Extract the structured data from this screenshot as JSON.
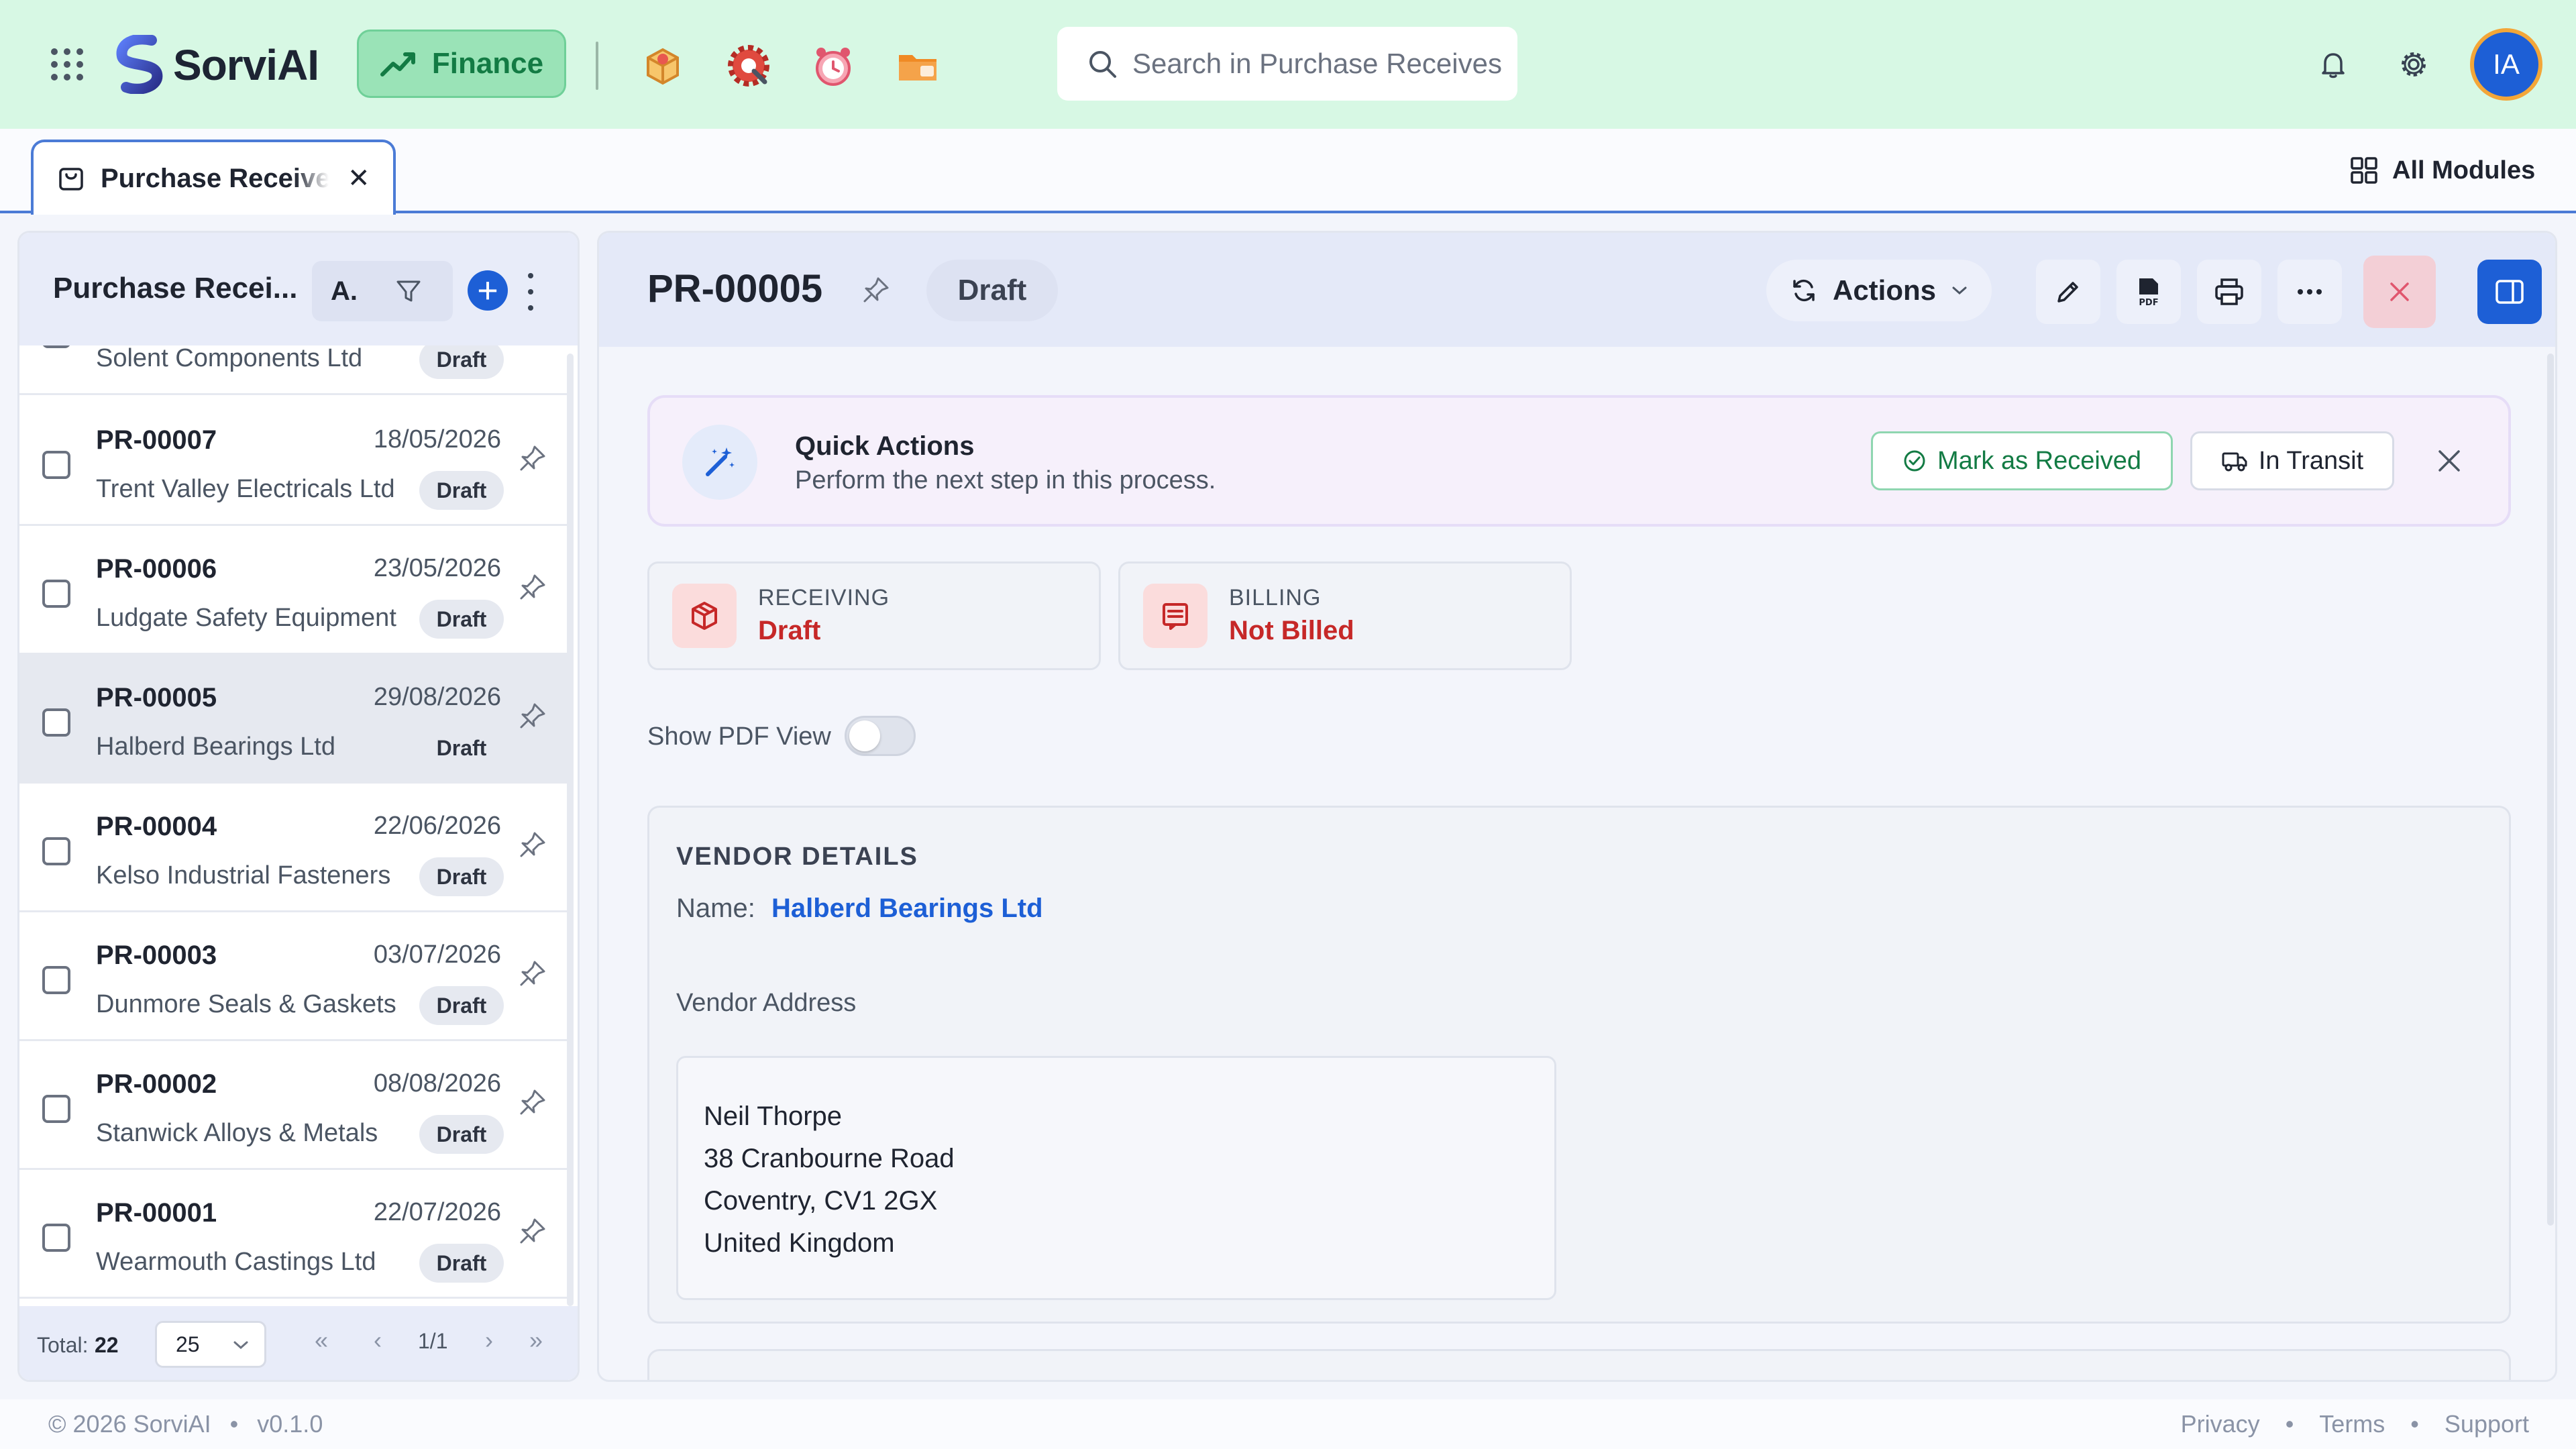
{
  "app": {
    "brand": "SorviAI",
    "module": "Finance"
  },
  "search": {
    "placeholder": "Search in Purchase Receives"
  },
  "user": {
    "initials": "IA"
  },
  "tab": {
    "label": "Purchase Receives",
    "all_modules": "All Modules"
  },
  "list": {
    "title": "Purchase Recei...",
    "sort_label": "A.",
    "rows": [
      {
        "number": "",
        "date": "",
        "vendor": "Solent Components Ltd",
        "status": "Draft"
      },
      {
        "number": "PR-00007",
        "date": "18/05/2026",
        "vendor": "Trent Valley Electricals Ltd",
        "status": "Draft"
      },
      {
        "number": "PR-00006",
        "date": "23/05/2026",
        "vendor": "Ludgate Safety Equipment",
        "status": "Draft"
      },
      {
        "number": "PR-00005",
        "date": "29/08/2026",
        "vendor": "Halberd Bearings Ltd",
        "status": "Draft"
      },
      {
        "number": "PR-00004",
        "date": "22/06/2026",
        "vendor": "Kelso Industrial Fasteners",
        "status": "Draft"
      },
      {
        "number": "PR-00003",
        "date": "03/07/2026",
        "vendor": "Dunmore Seals & Gaskets",
        "status": "Draft"
      },
      {
        "number": "PR-00002",
        "date": "08/08/2026",
        "vendor": "Stanwick Alloys & Metals",
        "status": "Draft"
      },
      {
        "number": "PR-00001",
        "date": "22/07/2026",
        "vendor": "Wearmouth Castings Ltd",
        "status": "Draft"
      }
    ],
    "footer": {
      "total_label": "Total:",
      "total": "22",
      "page_size": "25",
      "page": "1/1"
    }
  },
  "detail": {
    "number": "PR-00005",
    "status": "Draft",
    "actions_label": "Actions",
    "quick_actions": {
      "title": "Quick Actions",
      "subtitle": "Perform the next step in this process.",
      "mark_received": "Mark as Received",
      "in_transit": "In Transit"
    },
    "receiving": {
      "label": "RECEIVING",
      "value": "Draft"
    },
    "billing": {
      "label": "BILLING",
      "value": "Not Billed"
    },
    "pdf_toggle": {
      "label": "Show PDF View",
      "on": false
    },
    "vendor": {
      "section_title": "VENDOR DETAILS",
      "name_label": "Name:",
      "name": "Halberd Bearings Ltd",
      "address_label": "Vendor Address",
      "address": [
        "Neil Thorpe",
        "38 Cranbourne Road",
        "Coventry, CV1 2GX",
        "United Kingdom"
      ]
    }
  },
  "footer": {
    "copyright": "© 2026 SorviAI",
    "version": "v0.1.0",
    "links": [
      "Privacy",
      "Terms",
      "Support"
    ]
  },
  "colors": {
    "accent": "#1d5fd6",
    "topbar": "#d7f8e4",
    "finance": "#137b44",
    "danger": "#c62828"
  }
}
